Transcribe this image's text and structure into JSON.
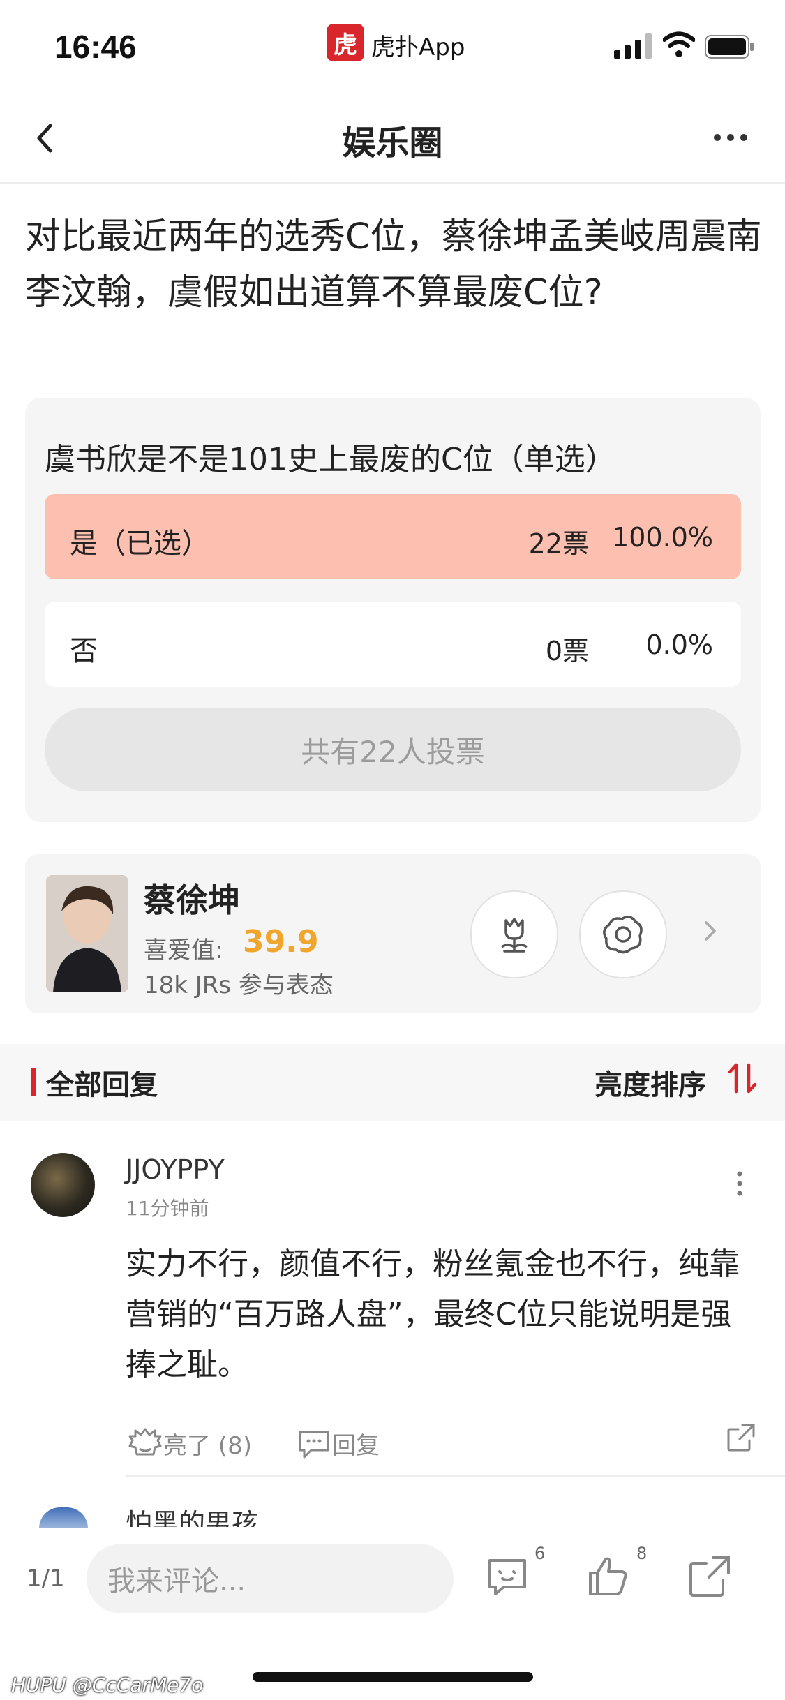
{
  "status_bar": {
    "time": "16:46",
    "app_logo_glyph": "虎",
    "app_name": "虎扑App"
  },
  "nav": {
    "title": "娱乐圈"
  },
  "post": {
    "title": "对比最近两年的选秀C位，蔡徐坤孟美岐周震南李汶翰，虞假如出道算不算最废C位?"
  },
  "poll": {
    "question": "虞书欣是不是101史上最废的C位（单选）",
    "options": [
      {
        "label": "是（已选）",
        "votes": "22票",
        "percent": "100.0%",
        "selected": true
      },
      {
        "label": "否",
        "votes": "0票",
        "percent": "0.0%",
        "selected": false
      }
    ],
    "total": "共有22人投票",
    "selected_color": "#fdbfaf"
  },
  "idol_card": {
    "name": "蔡徐坤",
    "love_label": "喜爱值:",
    "love_value": "39.9",
    "participants": "18k JRs 参与表态",
    "buttons": [
      "flower-icon",
      "rotten-egg-icon"
    ]
  },
  "replies": {
    "title": "全部回复",
    "sort_label": "亮度排序",
    "accent_color": "#d9262c"
  },
  "comments": [
    {
      "user": "JJOYPPY",
      "time": "11分钟前",
      "body": "实力不行，颜值不行，粉丝氪金也不行，纯靠营销的“百万路人盘”，最终C位只能说明是强捧之耻。",
      "like_label": "亮了 (8)",
      "reply_label": "回复"
    }
  ],
  "next_comment": {
    "user": "怕黑的男孩"
  },
  "bottom_bar": {
    "page_indicator": "1/1",
    "comment_placeholder": "我来评论...",
    "comments_count": "6",
    "likes_count": "8"
  },
  "watermark": "HUPU @CcCarMe7o"
}
